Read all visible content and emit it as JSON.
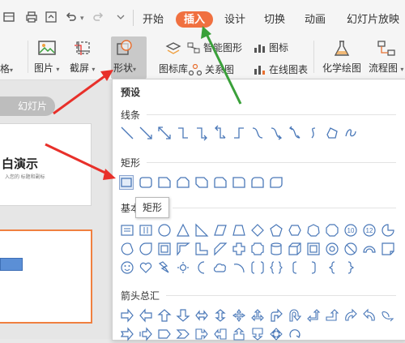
{
  "tabs": [
    {
      "label": "开始"
    },
    {
      "label": "插入",
      "active": true
    },
    {
      "label": "设计"
    },
    {
      "label": "切换"
    },
    {
      "label": "动画"
    },
    {
      "label": "幻灯片放映"
    }
  ],
  "ribbon": {
    "left_cut": "格",
    "picture": "图片",
    "screenshot": "截屏",
    "shapes": "形状",
    "icon_library": "图标库",
    "smart_graphic": "智能图形",
    "relation_graph": "关系图",
    "icons": "图标",
    "online_chart": "在线图表",
    "chem_drawing": "化学绘图",
    "flowchart": "流程图"
  },
  "left_panel": {
    "tab_label": "幻灯片",
    "thumb1_title": "白演示",
    "thumb1_sub": "入您的 标题和副标"
  },
  "dropdown": {
    "preset": "预设",
    "sections": {
      "lines": "线条",
      "rect": "矩形",
      "basic": "基本",
      "arrows": "箭头总汇"
    },
    "tooltip": "矩形"
  },
  "colors": {
    "accent": "#f07040",
    "arrow_red": "#e8302a",
    "arrow_green": "#3aa03a",
    "shape_blue": "#4a78b8"
  }
}
